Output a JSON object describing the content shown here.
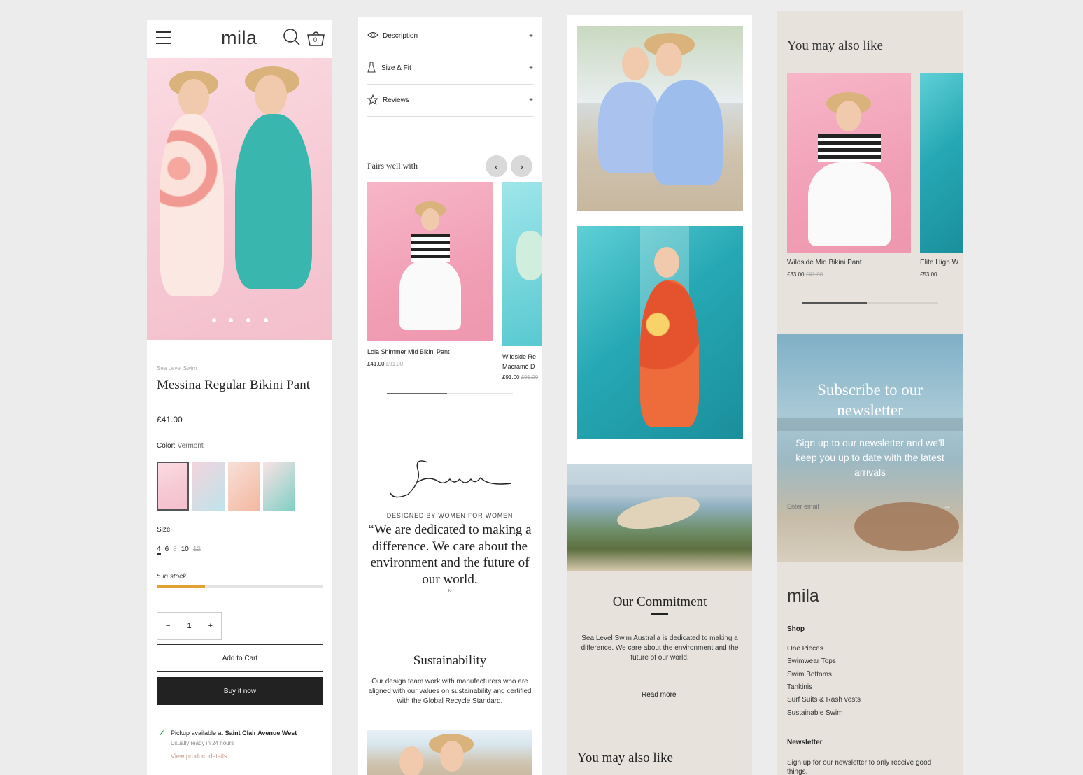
{
  "panel1": {
    "logo": "mila",
    "cart_count": "0",
    "brand": "Sea Level Swim",
    "product_title": "Messina Regular Bikini Pant",
    "price": "£41.00",
    "color_label": "Color:",
    "color_value": "Vermont",
    "size_label": "Size",
    "sizes": [
      "4",
      "6",
      "8",
      "10",
      "12"
    ],
    "stock_text": "5 in stock",
    "stock_fraction": 0.29,
    "quantity": "1",
    "qty_minus": "−",
    "qty_plus": "+",
    "add_to_cart": "Add to Cart",
    "buy_now": "Buy it now",
    "pickup_prefix": "Pickup available at",
    "pickup_location": "Saint Clair Avenue West",
    "pickup_ready": "Usually ready in 24 hours",
    "view_details": "View product details"
  },
  "panel2": {
    "accordion": [
      {
        "label": "Description",
        "icon": "eye-icon"
      },
      {
        "label": "Size & Fit",
        "icon": "dress-icon"
      },
      {
        "label": "Reviews",
        "icon": "star-icon"
      }
    ],
    "pairs_title": "Pairs well with",
    "products": [
      {
        "name": "Lola Shimmer Mid Bikini Pant",
        "price": "£41.00",
        "old_price": "£91.00"
      },
      {
        "name": "Wildside Re Macramé D",
        "price": "£91.00",
        "old_price": "£91.00"
      }
    ],
    "signature": "Swim",
    "designed_by": "DESIGNED BY WOMEN FOR WOMEN",
    "quote": "“We are dedicated to making a difference. We care about the environment and the future of our world.",
    "quote_close": "”",
    "sustain_title": "Sustainability",
    "sustain_body": "Our design team work with manufacturers who are aligned with our values on sustainability and certified with the Global Recycle Standard."
  },
  "panel3": {
    "commitment_title": "Our Commitment",
    "commitment_body": "Sea Level Swim Australia is dedicated to making a difference. We care about the environment and the future of our world.",
    "read_more": "Read more",
    "also_like": "You may also like"
  },
  "panel4": {
    "also_like": "You may also like",
    "products": [
      {
        "name": "Wildside Mid Bikini Pant",
        "price": "£33.00",
        "old_price": "£41.00"
      },
      {
        "name": "Elite High W",
        "price": "£53.00",
        "old_price": ""
      }
    ],
    "newsletter_title": "Subscribe to our newsletter",
    "newsletter_body": "Sign up to our newsletter and we'll keep you up to date with the latest arrivals",
    "email_placeholder": "Enter email",
    "footer_logo": "mila",
    "shop_heading": "Shop",
    "shop_links": [
      "One Pieces",
      "Swimwear Tops",
      "Swim Bottoms",
      "Tankinis",
      "Surf Suits & Rash vests",
      "Sustainable Swim"
    ],
    "newsletter_heading": "Newsletter",
    "newsletter_footer": "Sign up for our newsletter to only receive good things."
  }
}
